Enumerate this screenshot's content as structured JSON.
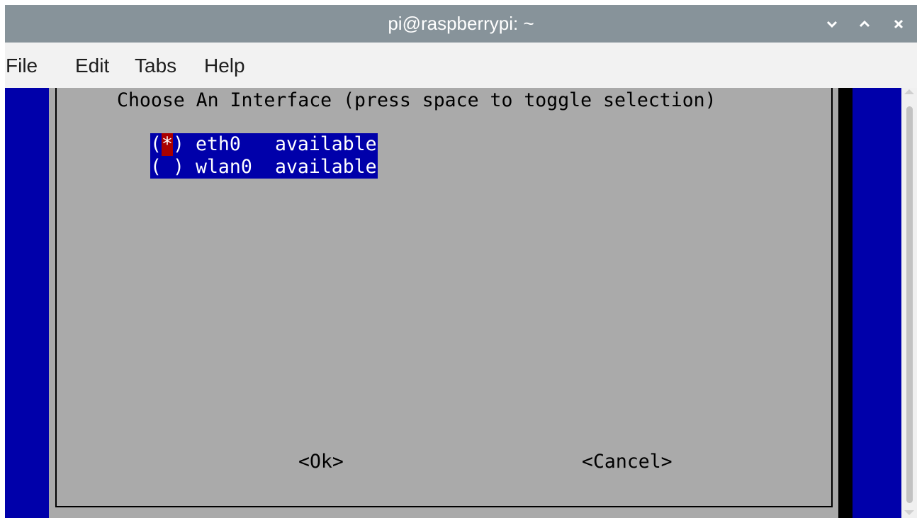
{
  "window": {
    "title": "pi@raspberrypi: ~",
    "controls": {
      "minimize_icon": "chevron-down-icon",
      "maximize_icon": "chevron-up-icon",
      "close_icon": "close-icon"
    }
  },
  "menu": [
    "File",
    "Edit",
    "Tabs",
    "Help"
  ],
  "dialog": {
    "prompt": "Choose An Interface (press space to toggle selection)",
    "options": [
      {
        "mark_open": "(",
        "mark": "*",
        "mark_close": ")",
        "name": "eth0",
        "status": "available",
        "selected": true
      },
      {
        "mark_open": "(",
        "mark": " ",
        "mark_close": ")",
        "name": "wlan0",
        "status": "available",
        "selected": false
      }
    ],
    "ok_label": "<Ok>",
    "cancel_label": "<Cancel>"
  },
  "colors": {
    "titlebar": "#87939a",
    "menubar": "#f2f2f2",
    "terminal_background": "#0000aa",
    "dialog_background": "#aaaaaa",
    "selection": "#0000aa",
    "cursor": "#aa0000"
  }
}
